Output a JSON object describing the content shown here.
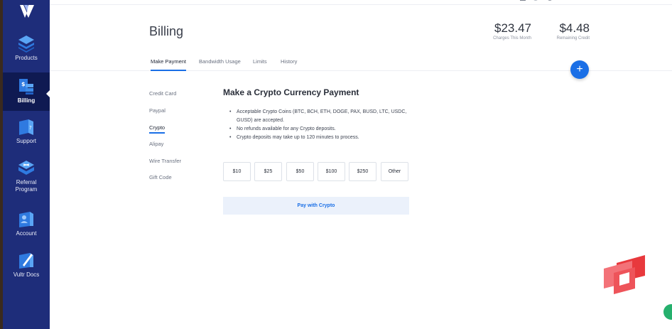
{
  "sidebar": {
    "items": [
      {
        "label": "Products"
      },
      {
        "label": "Billing"
      },
      {
        "label": "Support"
      },
      {
        "label": "Referral Program"
      },
      {
        "label": "Account"
      },
      {
        "label": "Vultr Docs"
      }
    ]
  },
  "header": {
    "title": "Billing",
    "charges": {
      "value": "$23.47",
      "label": "Charges This Month"
    },
    "credit": {
      "value": "$4.48",
      "label": "Remaining Credit"
    }
  },
  "tabs": [
    {
      "label": "Make Payment"
    },
    {
      "label": "Bandwidth Usage"
    },
    {
      "label": "Limits"
    },
    {
      "label": "History"
    }
  ],
  "fab": {
    "label": "+"
  },
  "payment_methods": [
    {
      "label": "Credit Card"
    },
    {
      "label": "Paypal"
    },
    {
      "label": "Crypto"
    },
    {
      "label": "Alipay"
    },
    {
      "label": "Wire Transfer"
    },
    {
      "label": "Gift Code"
    }
  ],
  "crypto": {
    "title": "Make a Crypto Currency Payment",
    "bullets": [
      "Acceptable Crypto Coins (BTC, BCH, ETH, DOGE, PAX, BUSD, LTC, USDC, GUSD) are accepted.",
      "No refunds available for any Crypto deposits.",
      "Crypto deposits may take up to 120 minutes to process."
    ],
    "amounts": [
      "$10",
      "$25",
      "$50",
      "$100",
      "$250",
      "Other"
    ],
    "pay_label": "Pay with Crypto"
  },
  "colors": {
    "sidebar": "#1e2d7a",
    "accent": "#1a6fe6",
    "chat_logo": "#e8393d"
  },
  "icons": {
    "logo": "vultr-logo-icon",
    "products": "cube-stack-icon",
    "billing": "billing-icon",
    "support": "support-icon",
    "referral": "referral-icon",
    "account": "account-icon",
    "docs": "docs-icon"
  }
}
